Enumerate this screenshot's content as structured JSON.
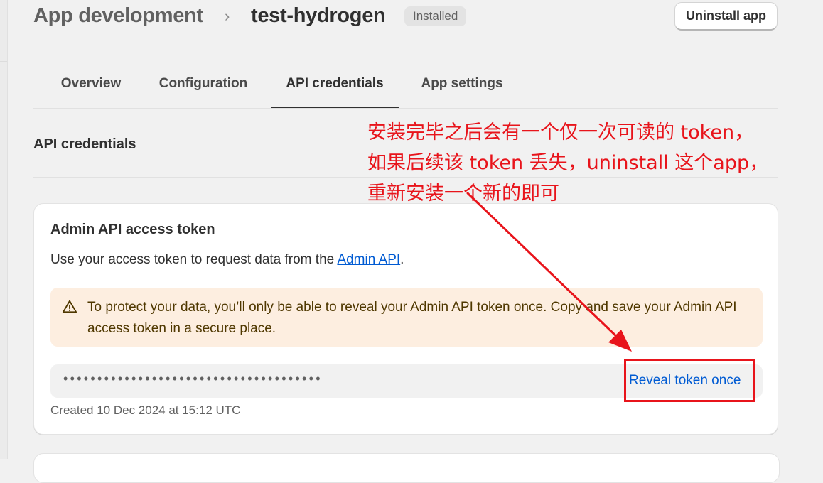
{
  "header": {
    "breadcrumb": "App development",
    "title": "test-hydrogen",
    "status_badge": "Installed",
    "uninstall_label": "Uninstall app"
  },
  "tabs": [
    {
      "label": "Overview",
      "active": false
    },
    {
      "label": "Configuration",
      "active": false
    },
    {
      "label": "API credentials",
      "active": true
    },
    {
      "label": "App settings",
      "active": false
    }
  ],
  "section": {
    "title": "API credentials"
  },
  "card": {
    "title": "Admin API access token",
    "desc_prefix": "Use your access token to request data from the ",
    "desc_link": "Admin API",
    "desc_suffix": ".",
    "warning_text": "To protect your data, you’ll only be able to reveal your Admin API token once. Copy and save your Admin API access token in a secure place.",
    "token_masked": "••••••••••••••••••••••••••••••••••••••",
    "reveal_label": "Reveal token once",
    "created_text": "Created 10 Dec 2024 at 15:12 UTC"
  },
  "annotation": {
    "lines": [
      "安装完毕之后会有一个仅一次可读的 token，",
      "如果后续该 token 丢失，uninstall 这个app，",
      "重新安装一个新的即可"
    ],
    "color": "#e8141b"
  },
  "colors": {
    "link": "#005bd3",
    "warning_bg": "#fdeee0",
    "background": "#f1f1f1"
  },
  "icons": {
    "warning": "warning-triangle-icon",
    "breadcrumb_separator": "chevron-right-icon"
  }
}
